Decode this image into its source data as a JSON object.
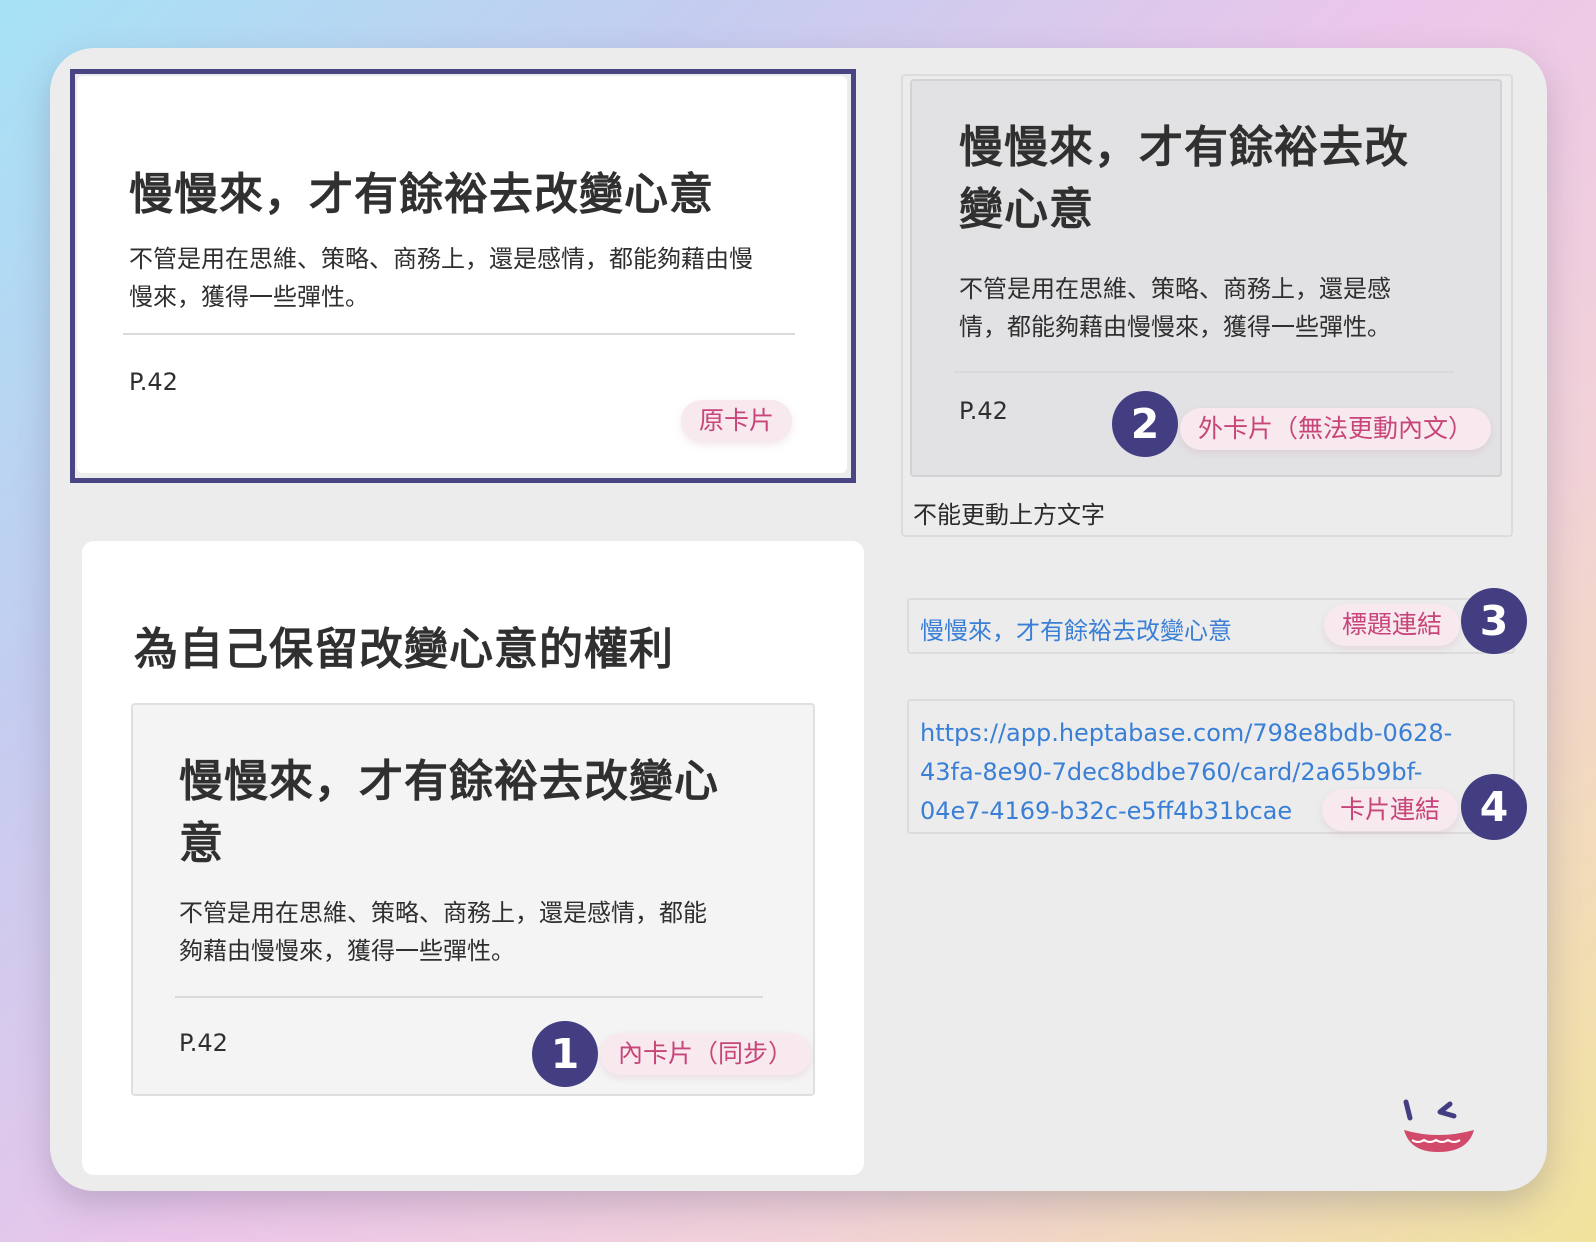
{
  "card_title": "慢慢來，才有餘裕去改變心意",
  "card_body": "不管是用在思維、策略、商務上，還是感情，都能夠藉由慢慢來，獲得一些彈性。",
  "page_ref": "P.42",
  "original_card": {
    "title_line": "慢慢來，才有餘裕去改變心意",
    "body_lines": [
      "不管是用在思維、策略、商務上，還是感情，都能夠藉由慢",
      "慢來，獲得一些彈性。"
    ],
    "page": "P.42",
    "tag": "原卡片"
  },
  "external_card": {
    "title_lines": [
      "慢慢來，才有餘裕去改",
      "變心意"
    ],
    "body_lines": [
      "不管是用在思維、策略、商務上，還是感",
      "情，都能夠藉由慢慢來，獲得一些彈性。"
    ],
    "page": "P.42",
    "badge": "2",
    "tag": "外卡片（無法更動內文）",
    "caption": "不能更動上方文字"
  },
  "container_card": {
    "title": "為自己保留改變心意的權利",
    "inner_card": {
      "title_lines": [
        "慢慢來，才有餘裕去改變心",
        "意"
      ],
      "body_lines": [
        "不管是用在思維、策略、商務上，還是感情，都能",
        "夠藉由慢慢來，獲得一些彈性。"
      ],
      "page": "P.42",
      "badge": "1",
      "tag": "內卡片（同步）"
    }
  },
  "title_link": {
    "text": "慢慢來，才有餘裕去改變心意",
    "tag": "標題連結",
    "badge": "3"
  },
  "card_link": {
    "lines": [
      "https://app.heptabase.com/798e8bdb-0628-",
      "43fa-8e90-7dec8bdbe760/card/2a65b9bf-",
      "04e7-4169-b32c-e5ff4b31bcae"
    ],
    "tag": "卡片連結",
    "badge": "4"
  },
  "colors": {
    "accent": "#433e82",
    "tag_text": "#c8457a",
    "tag_bg": "#f7e9ee",
    "link": "#3a7fd6"
  }
}
